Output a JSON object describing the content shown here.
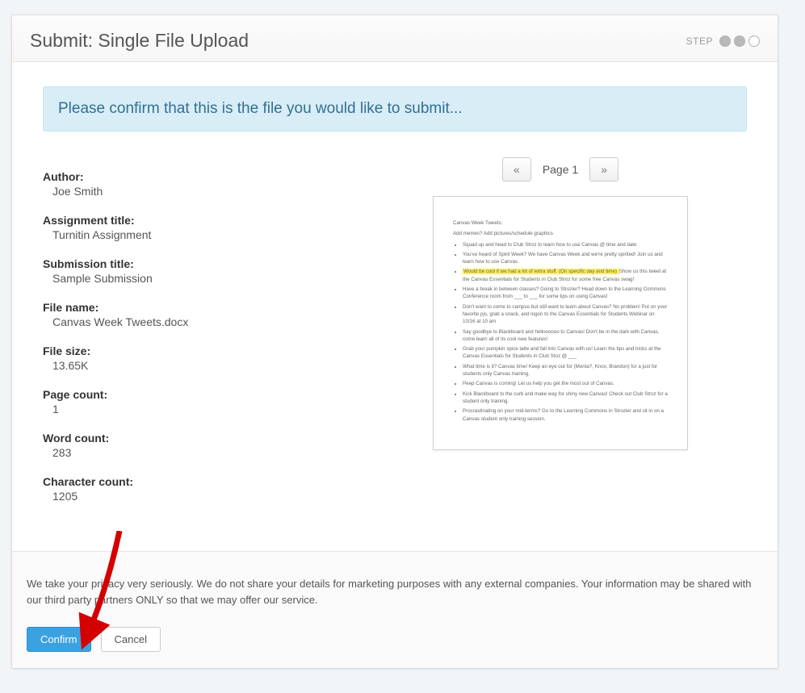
{
  "header": {
    "title": "Submit: Single File Upload",
    "step_label": "STEP"
  },
  "alert": {
    "message": "Please confirm that this is the file you would like to submit..."
  },
  "meta": {
    "author_label": "Author:",
    "author_value": "Joe Smith",
    "assignment_label": "Assignment title:",
    "assignment_value": "Turnitin Assignment",
    "submission_label": "Submission title:",
    "submission_value": "Sample Submission",
    "filename_label": "File name:",
    "filename_value": "Canvas Week Tweets.docx",
    "filesize_label": "File size:",
    "filesize_value": "13.65K",
    "pagecount_label": "Page count:",
    "pagecount_value": "1",
    "wordcount_label": "Word count:",
    "wordcount_value": "283",
    "charcount_label": "Character count:",
    "charcount_value": "1205"
  },
  "pager": {
    "prev_glyph": "«",
    "label": "Page 1",
    "next_glyph": "»"
  },
  "preview": {
    "title": "Canvas Week Tweets:",
    "subtitle": "Add memes? Add pictures/schedule graphics",
    "highlight": "Would be cool if we had a lot of extra stuff. (On specific day and time)",
    "bullets": [
      "Squad up and head to Club Stroz to learn how to use Canvas @ time and date",
      "You've heard of Spirit Week? We have Canvas Week and we're pretty spirited! Join us and learn how to use Canvas",
      "Show us this tweet at the Canvas Essentials for Students in Club Stroz for some free Canvas swag!",
      "Have a break in between classes? Going to Strozier? Head down to the Learning Commons Conference room from ___ to ___ for some tips on using Canvas!",
      "Don't want to come to campus but still want to learn about Canvas? No problem! Put on your favorite pjs, grab a snack, and logon to the Canvas Essentials for Students Webinar on 10/16 at 10 am",
      "Say goodbye to Blackboard and helloooooo to Canvas! Don't be in the dark with Canvas, come learn all of its cool new features!",
      "Grab your pumpkin spice latte and fall into Canvas with us! Learn the tips and tricks at the Canvas Essentials for Students in Club Stoz @ ___",
      "What time is it? Canvas time! Keep an eye out for (Monta?, Knox, Brandon) for a just for students only Canvas training.",
      "Peep Canvas is coming! Let us help you get the most out of Canvas.",
      "Kick Blackboard to the curb and make way for shiny new Canvas! Check out Club Stroz for a student only training.",
      "Procrastinating on your mid-terms? Go to the Learning Commons in Strozier and sit in on a Canvas student only training session."
    ]
  },
  "footer": {
    "privacy": "We take your privacy very seriously. We do not share your details for marketing purposes with any external companies. Your information may be shared with our third party partners ONLY so that we may offer our service.",
    "confirm_label": "Confirm",
    "cancel_label": "Cancel"
  }
}
